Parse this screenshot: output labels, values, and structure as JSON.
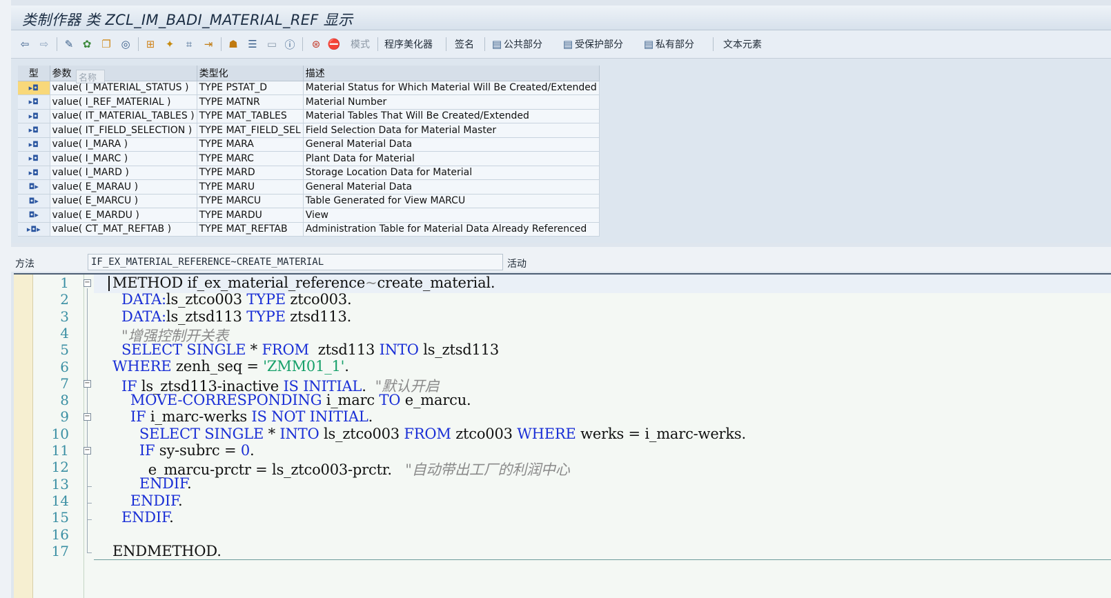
{
  "title": "类制作器 类 ZCL_IM_BADI_MATERIAL_REF 显示",
  "toolbar": {
    "mode_label": "模式",
    "pretty_printer_label": "程序美化器",
    "signature_label": "签名",
    "public_section_label": "公共部分",
    "protected_section_label": "受保护部分",
    "private_section_label": "私有部分",
    "text_elements_label": "文本元素"
  },
  "params": {
    "headers": [
      "型",
      "参数",
      "类型化",
      "描述"
    ],
    "tooltip": "名称",
    "rows": [
      {
        "kind": "▸◘",
        "param": "value( I_MATERIAL_STATUS )",
        "type": "TYPE PSTAT_D",
        "desc": "Material Status for Which Material Will Be Created/Extended"
      },
      {
        "kind": "▸◘",
        "param": "value( I_REF_MATERIAL )",
        "type": "TYPE MATNR",
        "desc": "Material Number"
      },
      {
        "kind": "▸◘",
        "param": "value( IT_MATERIAL_TABLES )",
        "type": "TYPE MAT_TABLES",
        "desc": "Material Tables That Will Be Created/Extended"
      },
      {
        "kind": "▸◘",
        "param": "value( IT_FIELD_SELECTION )",
        "type": "TYPE MAT_FIELD_SEL",
        "desc": "Field Selection Data for Material Master"
      },
      {
        "kind": "▸◘",
        "param": "value( I_MARA )",
        "type": "TYPE MARA",
        "desc": "General Material Data"
      },
      {
        "kind": "▸◘",
        "param": "value( I_MARC )",
        "type": "TYPE MARC",
        "desc": "Plant Data for Material"
      },
      {
        "kind": "▸◘",
        "param": "value( I_MARD )",
        "type": "TYPE MARD",
        "desc": "Storage Location Data for Material"
      },
      {
        "kind": "◘▸",
        "param": "value( E_MARAU )",
        "type": "TYPE MARU",
        "desc": "General Material Data"
      },
      {
        "kind": "◘▸",
        "param": "value( E_MARCU )",
        "type": "TYPE MARCU",
        "desc": "Table Generated for View MARCU"
      },
      {
        "kind": "◘▸",
        "param": "value( E_MARDU )",
        "type": "TYPE MARDU",
        "desc": "View"
      },
      {
        "kind": "▸◘▸",
        "param": "value( CT_MAT_REFTAB )",
        "type": "TYPE MAT_REFTAB",
        "desc": "Administration Table for Material Data Already Referenced"
      }
    ]
  },
  "method": {
    "label": "方法",
    "value": "IF_EX_MATERIAL_REFERENCE~CREATE_MATERIAL",
    "status": "活动"
  },
  "code": {
    "line_numbers": [
      "1",
      "2",
      "3",
      "4",
      "5",
      "6",
      "7",
      "8",
      "9",
      "10",
      "11",
      "12",
      "13",
      "14",
      "15",
      "16",
      "17"
    ]
  }
}
